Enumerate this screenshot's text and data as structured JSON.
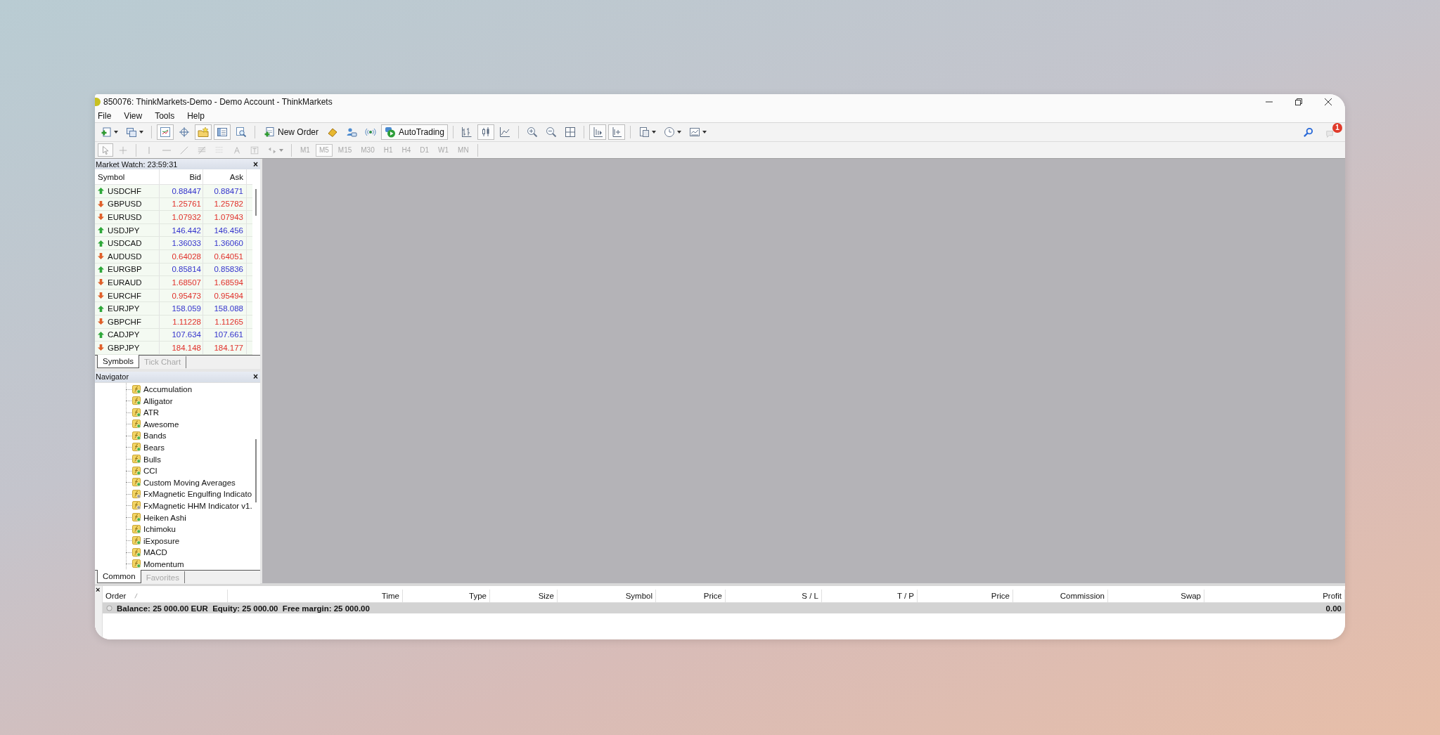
{
  "window": {
    "title": "850076: ThinkMarkets-Demo - Demo Account - ThinkMarkets"
  },
  "menu": [
    "File",
    "View",
    "Tools",
    "Help"
  ],
  "toolbar": {
    "items": [
      {
        "kind": "icon",
        "pressed": false,
        "dropdown": true
      },
      {
        "kind": "icon",
        "pressed": false,
        "dropdown": true
      },
      {
        "kind": "separator"
      },
      {
        "kind": "icon",
        "pressed": true,
        "dropdown": false
      },
      {
        "kind": "icon",
        "pressed": false,
        "dropdown": false
      },
      {
        "kind": "icon",
        "pressed": true,
        "dropdown": false
      },
      {
        "kind": "icon",
        "pressed": true,
        "dropdown": false
      },
      {
        "kind": "icon",
        "pressed": false,
        "dropdown": false
      },
      {
        "kind": "separator"
      },
      {
        "kind": "text_button",
        "label": "New Order",
        "pressed": false
      },
      {
        "kind": "icon",
        "pressed": false,
        "dropdown": false
      },
      {
        "kind": "icon",
        "pressed": false,
        "dropdown": false
      },
      {
        "kind": "icon",
        "pressed": false,
        "dropdown": false
      },
      {
        "kind": "text_button",
        "label": "AutoTrading",
        "pressed": true
      },
      {
        "kind": "separator"
      },
      {
        "kind": "icon",
        "pressed": false,
        "dropdown": false
      },
      {
        "kind": "icon",
        "pressed": true,
        "dropdown": false
      },
      {
        "kind": "icon",
        "pressed": false,
        "dropdown": false
      },
      {
        "kind": "separator"
      },
      {
        "kind": "icon",
        "pressed": false,
        "dropdown": false
      },
      {
        "kind": "icon",
        "pressed": false,
        "dropdown": false
      },
      {
        "kind": "icon",
        "pressed": false,
        "dropdown": false
      },
      {
        "kind": "separator"
      },
      {
        "kind": "icon",
        "pressed": true,
        "dropdown": false
      },
      {
        "kind": "icon",
        "pressed": true,
        "dropdown": false
      },
      {
        "kind": "separator"
      },
      {
        "kind": "icon",
        "pressed": false,
        "dropdown": true
      },
      {
        "kind": "icon",
        "pressed": false,
        "dropdown": true
      },
      {
        "kind": "icon",
        "pressed": false,
        "dropdown": true
      }
    ]
  },
  "notifications": {
    "badge": "1"
  },
  "drawing_toolbar": {
    "items": [
      {
        "kind": "icon",
        "pressed": true,
        "dropdown": false
      },
      {
        "kind": "icon",
        "pressed": false,
        "dropdown": false
      },
      {
        "kind": "separator"
      },
      {
        "kind": "icon",
        "pressed": false,
        "dropdown": false
      },
      {
        "kind": "icon",
        "pressed": false,
        "dropdown": false
      },
      {
        "kind": "icon",
        "pressed": false,
        "dropdown": false
      },
      {
        "kind": "icon",
        "pressed": false,
        "dropdown": false
      },
      {
        "kind": "icon",
        "pressed": false,
        "dropdown": false
      },
      {
        "kind": "icon",
        "pressed": false,
        "dropdown": false
      },
      {
        "kind": "icon",
        "pressed": false,
        "dropdown": false
      },
      {
        "kind": "icon",
        "pressed": false,
        "dropdown": true
      },
      {
        "kind": "separator"
      }
    ],
    "timeframes": [
      {
        "label": "M1",
        "selected": false
      },
      {
        "label": "M5",
        "selected": true
      },
      {
        "label": "M15",
        "selected": false
      },
      {
        "label": "M30",
        "selected": false
      },
      {
        "label": "H1",
        "selected": false
      },
      {
        "label": "H4",
        "selected": false
      },
      {
        "label": "D1",
        "selected": false
      },
      {
        "label": "W1",
        "selected": false
      },
      {
        "label": "MN",
        "selected": false
      }
    ]
  },
  "market_watch": {
    "title": "Market Watch: 23:59:31",
    "close": "×",
    "columns": [
      "Symbol",
      "Bid",
      "Ask"
    ],
    "rows": [
      {
        "symbol": "USDCHF",
        "bid": "0.88447",
        "ask": "0.88471",
        "rising": true
      },
      {
        "symbol": "GBPUSD",
        "bid": "1.25761",
        "ask": "1.25782",
        "rising": false
      },
      {
        "symbol": "EURUSD",
        "bid": "1.07932",
        "ask": "1.07943",
        "rising": false
      },
      {
        "symbol": "USDJPY",
        "bid": "146.442",
        "ask": "146.456",
        "rising": true
      },
      {
        "symbol": "USDCAD",
        "bid": "1.36033",
        "ask": "1.36060",
        "rising": true
      },
      {
        "symbol": "AUDUSD",
        "bid": "0.64028",
        "ask": "0.64051",
        "rising": false
      },
      {
        "symbol": "EURGBP",
        "bid": "0.85814",
        "ask": "0.85836",
        "rising": true
      },
      {
        "symbol": "EURAUD",
        "bid": "1.68507",
        "ask": "1.68594",
        "rising": false
      },
      {
        "symbol": "EURCHF",
        "bid": "0.95473",
        "ask": "0.95494",
        "rising": false
      },
      {
        "symbol": "EURJPY",
        "bid": "158.059",
        "ask": "158.088",
        "rising": true
      },
      {
        "symbol": "GBPCHF",
        "bid": "1.11228",
        "ask": "1.11265",
        "rising": false
      },
      {
        "symbol": "CADJPY",
        "bid": "107.634",
        "ask": "107.661",
        "rising": true
      },
      {
        "symbol": "GBPJPY",
        "bid": "184.148",
        "ask": "184.177",
        "rising": false
      }
    ],
    "tabs": [
      {
        "label": "Symbols",
        "selected": true
      },
      {
        "label": "Tick Chart",
        "selected": false
      }
    ]
  },
  "navigator": {
    "title": "Navigator",
    "close": "×",
    "items": [
      {
        "name": "Accumulation",
        "kind": "standard"
      },
      {
        "name": "Alligator",
        "kind": "standard"
      },
      {
        "name": "ATR",
        "kind": "standard"
      },
      {
        "name": "Awesome",
        "kind": "standard"
      },
      {
        "name": "Bands",
        "kind": "standard"
      },
      {
        "name": "Bears",
        "kind": "standard"
      },
      {
        "name": "Bulls",
        "kind": "standard"
      },
      {
        "name": "CCI",
        "kind": "standard"
      },
      {
        "name": "Custom Moving Averages",
        "kind": "standard"
      },
      {
        "name": "FxMagnetic Engulfing Indicato",
        "kind": "custom"
      },
      {
        "name": "FxMagnetic HHM Indicator v1.",
        "kind": "custom"
      },
      {
        "name": "Heiken Ashi",
        "kind": "standard"
      },
      {
        "name": "Ichimoku",
        "kind": "standard"
      },
      {
        "name": "iExposure",
        "kind": "standard"
      },
      {
        "name": "MACD",
        "kind": "standard"
      },
      {
        "name": "Momentum",
        "kind": "standard"
      }
    ],
    "tabs": [
      {
        "label": "Common",
        "selected": true
      },
      {
        "label": "Favorites",
        "selected": false
      }
    ]
  },
  "terminal": {
    "close": "×",
    "columns": [
      {
        "label": "Order",
        "sorted": true
      },
      {
        "label": "Time",
        "sorted": false
      },
      {
        "label": "Type",
        "sorted": false
      },
      {
        "label": "Size",
        "sorted": false
      },
      {
        "label": "Symbol",
        "sorted": false
      },
      {
        "label": "Price",
        "sorted": false
      },
      {
        "label": "S / L",
        "sorted": false
      },
      {
        "label": "T / P",
        "sorted": false
      },
      {
        "label": "Price",
        "sorted": false
      },
      {
        "label": "Commission",
        "sorted": false
      },
      {
        "label": "Swap",
        "sorted": false
      },
      {
        "label": "Profit",
        "sorted": false
      }
    ],
    "balance_line": "Balance: 25 000.00 EUR  Equity: 25 000.00  Free margin: 25 000.00",
    "profit": "0.00"
  }
}
